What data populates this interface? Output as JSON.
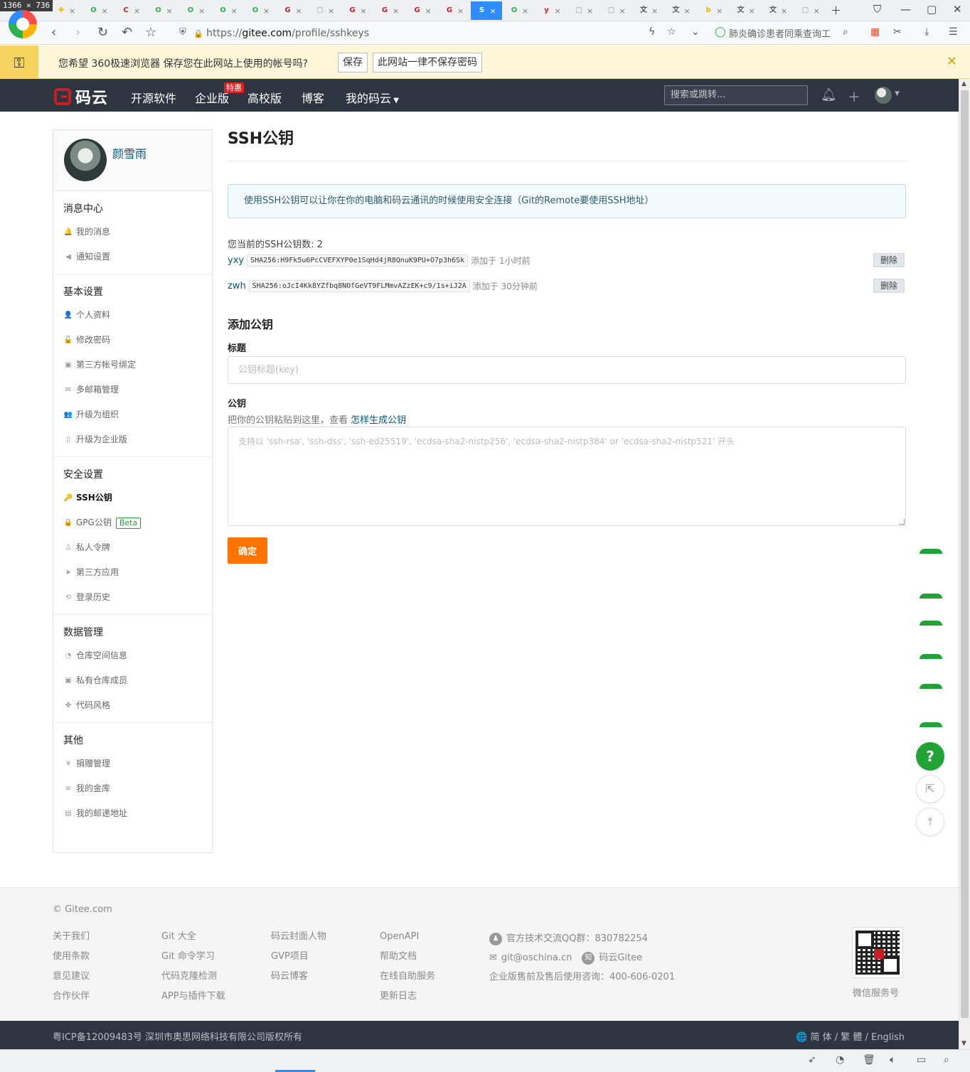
{
  "browser": {
    "dim_badge": "1366 × 736",
    "tabs": [
      {
        "glyph": "✚",
        "color": "#f2b600"
      },
      {
        "glyph": "O",
        "color": "#2bb24c"
      },
      {
        "glyph": "C",
        "color": "#c71d23"
      },
      {
        "glyph": "O",
        "color": "#2bb24c"
      },
      {
        "glyph": "O",
        "color": "#2bb24c"
      },
      {
        "glyph": "O",
        "color": "#2bb24c"
      },
      {
        "glyph": "O",
        "color": "#2bb24c"
      },
      {
        "glyph": "G",
        "color": "#c71d23"
      },
      {
        "glyph": "□",
        "color": "#999999"
      },
      {
        "glyph": "G",
        "color": "#c71d23"
      },
      {
        "glyph": "G",
        "color": "#c71d23"
      },
      {
        "glyph": "G",
        "color": "#c71d23"
      },
      {
        "glyph": "G",
        "color": "#c71d23"
      },
      {
        "glyph": "S",
        "color": "#2f8cff"
      },
      {
        "glyph": "O",
        "color": "#2bb24c"
      },
      {
        "glyph": "y",
        "color": "#e02020"
      },
      {
        "glyph": "□",
        "color": "#999999"
      },
      {
        "glyph": "□",
        "color": "#999999"
      },
      {
        "glyph": "文",
        "color": "#555555"
      },
      {
        "glyph": "文",
        "color": "#555555"
      },
      {
        "glyph": "b",
        "color": "#f2b600"
      },
      {
        "glyph": "文",
        "color": "#555555"
      },
      {
        "glyph": "文",
        "color": "#555555"
      },
      {
        "glyph": "□",
        "color": "#999999"
      }
    ],
    "url_prefix": "https://",
    "url_domain": "gitee.com",
    "url_path": "/profile/sshkeys",
    "search_suggestion": "肺炎确诊患者同乘查询工"
  },
  "pwbar": {
    "message": "您希望 360极速浏览器 保存您在此网站上使用的帐号吗?",
    "save": "保存",
    "never": "此网站一律不保存密码"
  },
  "header": {
    "logo_text": "码云",
    "nav": [
      "开源软件",
      "企业版",
      "高校版",
      "博客",
      "我的码云"
    ],
    "hot_badge": "特惠",
    "search_placeholder": "搜索或跳转..."
  },
  "sidebar": {
    "user_name": "颜雪雨",
    "groups": [
      {
        "title": "消息中心",
        "items": [
          {
            "icon": "🔔",
            "label": "我的消息"
          },
          {
            "icon": "◀",
            "label": "通知设置"
          }
        ]
      },
      {
        "title": "基本设置",
        "items": [
          {
            "icon": "👤",
            "label": "个人资料"
          },
          {
            "icon": "🔓",
            "label": "修改密码"
          },
          {
            "icon": "▣",
            "label": "第三方帐号绑定"
          },
          {
            "icon": "✉",
            "label": "多邮箱管理"
          },
          {
            "icon": "👥",
            "label": "升级为组织"
          },
          {
            "icon": "▯",
            "label": "升级为企业版"
          }
        ]
      },
      {
        "title": "安全设置",
        "items": [
          {
            "icon": "🔑",
            "label": "SSH公钥",
            "active": true
          },
          {
            "icon": "🔒",
            "label": "GPG公钥",
            "badge": "Beta"
          },
          {
            "icon": "♙",
            "label": "私人令牌"
          },
          {
            "icon": "➤",
            "label": "第三方应用"
          },
          {
            "icon": "⟲",
            "label": "登录历史"
          }
        ]
      },
      {
        "title": "数据管理",
        "items": [
          {
            "icon": "◔",
            "label": "仓库空间信息"
          },
          {
            "icon": "▣",
            "label": "私有仓库成员"
          },
          {
            "icon": "✤",
            "label": "代码风格"
          }
        ]
      },
      {
        "title": "其他",
        "items": [
          {
            "icon": "¥",
            "label": "捐赠管理"
          },
          {
            "icon": "≋",
            "label": "我的金库"
          },
          {
            "icon": "▤",
            "label": "我的邮递地址"
          }
        ]
      }
    ]
  },
  "main": {
    "title": "SSH公钥",
    "info": "使用SSH公钥可以让你在你的电脑和码云通讯的时候使用安全连接（Git的Remote要使用SSH地址）",
    "count_text": "您当前的SSH公钥数: 2",
    "keys": [
      {
        "name": "yxy",
        "fingerprint": "SHA256:H9Fk5u6PcCVEFXYP0e1SqHd4jR8QnuK9PU+O7p3h6Sk",
        "added": "添加于 1小时前",
        "delete": "删除"
      },
      {
        "name": "zwh",
        "fingerprint": "SHA256:oJcI4Kk8YZfbq8NOfGeVT9FLMmvAZzEK+c9/1s+iJ2A",
        "added": "添加于 30分钟前",
        "delete": "删除"
      }
    ],
    "add_title": "添加公钥",
    "label_title": "标题",
    "title_placeholder": "公钥标题(key)",
    "label_key": "公钥",
    "help_text": "把你的公钥粘贴到这里，查看 ",
    "help_link": "怎样生成公钥",
    "key_placeholder": "支持以 'ssh-rsa', 'ssh-dss', 'ssh-ed25519', 'ecdsa-sha2-nistp256', 'ecdsa-sha2-nistp384' or 'ecdsa-sha2-nistp521' 开头",
    "submit": "确定"
  },
  "floating": {
    "help": "?",
    "share": "⇱",
    "top": "⤒"
  },
  "footer": {
    "copyright": "© Gitee.com",
    "col1": [
      "关于我们",
      "使用条款",
      "意见建议",
      "合作伙伴"
    ],
    "col2": [
      "Git 大全",
      "Git 命令学习",
      "代码克隆检测",
      "APP与插件下载"
    ],
    "col3": [
      "码云封面人物",
      "GVP项目",
      "码云博客"
    ],
    "col4": [
      "OpenAPI",
      "帮助文档",
      "在线自助服务",
      "更新日志"
    ],
    "qq": "官方技术交流QQ群：830782254",
    "email": "git@oschina.cn",
    "zhihu": "码云Gitee",
    "sales": "企业版售前及售后使用咨询：400-606-0201",
    "wechat": "微信服务号",
    "icp": "粤ICP备12009483号 深圳市奥思网络科技有限公司版权所有",
    "lang": "🌐 简 体 / 繁 體 / English"
  }
}
